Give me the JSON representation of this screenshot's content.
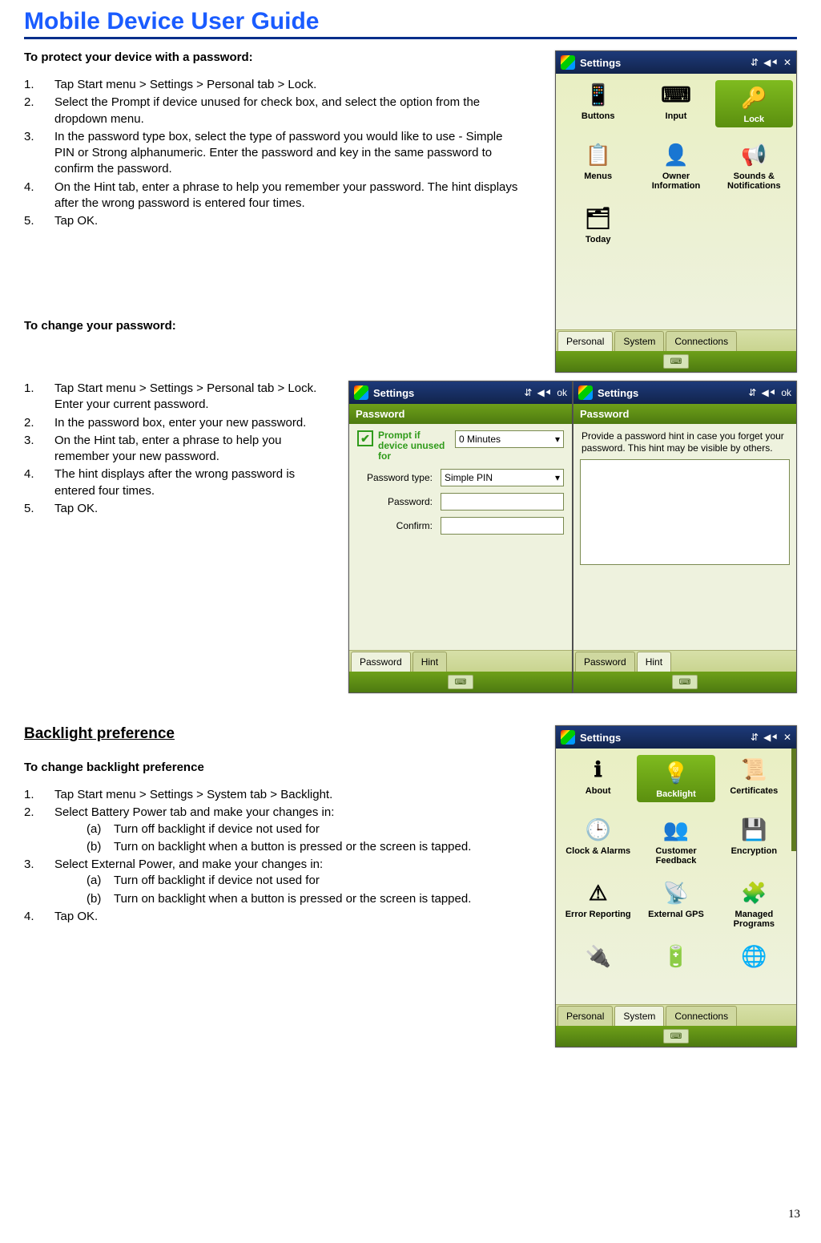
{
  "doc_title": "Mobile Device User Guide",
  "page_number": "13",
  "sections": {
    "protect_heading": "To protect your device with a password:",
    "protect_steps": [
      "Tap Start menu > Settings > Personal tab > Lock.",
      "Select the Prompt if device unused for check box, and select the option from the dropdown menu.",
      "In the password type box, select the type of password you would like to use - Simple PIN or Strong alphanumeric. Enter the password and key in the same password to confirm the password.",
      "On the Hint tab, enter a phrase to help you remember your password. The hint displays after the wrong password is entered four times.",
      "Tap OK."
    ],
    "change_heading": "To change your password:",
    "change_steps": [
      "Tap Start menu > Settings > Personal tab > Lock. Enter your current password.",
      "In the password box, enter your new password.",
      "On the Hint tab, enter a phrase to help you remember your new password.",
      "The hint displays after the wrong password is entered four times.",
      "Tap OK."
    ],
    "backlight_heading": "Backlight preference",
    "backlight_sub": "To change backlight preference",
    "backlight_steps": [
      {
        "text": "Tap Start menu > Settings > System tab > Backlight."
      },
      {
        "text": "Select Battery Power tab and make your changes in:",
        "sub": [
          {
            "k": "(a)",
            "v": "Turn off backlight if device not used for"
          },
          {
            "k": "(b)",
            "v": "Turn on backlight when a button is pressed or the screen is tapped."
          }
        ]
      },
      {
        "text": "Select External Power, and make your changes in:",
        "sub": [
          {
            "k": "(a)",
            "v": "Turn off backlight if device not used for"
          },
          {
            "k": "(b)",
            "v": "Turn on backlight when a button is pressed or the screen is tapped."
          }
        ]
      },
      {
        "text": "Tap OK."
      }
    ]
  },
  "screens": {
    "settings_personal": {
      "title": "Settings",
      "ok_label": "✕",
      "icons_sig": "⇵",
      "icons_vol": "◀⯇",
      "items": [
        {
          "label": "Buttons",
          "glyph": "📱"
        },
        {
          "label": "Input",
          "glyph": "⌨"
        },
        {
          "label": "Lock",
          "glyph": "🔑",
          "selected": true
        },
        {
          "label": "Menus",
          "glyph": "📋"
        },
        {
          "label": "Owner Information",
          "glyph": "👤"
        },
        {
          "label": "Sounds & Notifications",
          "glyph": "📢"
        },
        {
          "label": "Today",
          "glyph": "🗂"
        }
      ],
      "tabs": [
        "Personal",
        "System",
        "Connections"
      ],
      "active_tab": 0
    },
    "password_form": {
      "title": "Settings",
      "ok_label": "ok",
      "header": "Password",
      "prompt_label": "Prompt if device unused for",
      "prompt_checked": true,
      "timeout": "0 Minutes",
      "type_label": "Password type:",
      "type_value": "Simple PIN",
      "pwd_label": "Password:",
      "confirm_label": "Confirm:",
      "tabs": [
        "Password",
        "Hint"
      ],
      "active_tab": 0
    },
    "hint_form": {
      "title": "Settings",
      "ok_label": "ok",
      "header": "Password",
      "hint_text": "Provide a password hint in case you forget your password.  This hint may be visible by others.",
      "tabs": [
        "Password",
        "Hint"
      ],
      "active_tab": 1
    },
    "settings_system": {
      "title": "Settings",
      "ok_label": "✕",
      "items": [
        {
          "label": "About",
          "glyph": "ℹ"
        },
        {
          "label": "Backlight",
          "glyph": "💡",
          "selected": true
        },
        {
          "label": "Certificates",
          "glyph": "📜"
        },
        {
          "label": "Clock & Alarms",
          "glyph": "🕒"
        },
        {
          "label": "Customer Feedback",
          "glyph": "👥"
        },
        {
          "label": "Encryption",
          "glyph": "💾"
        },
        {
          "label": "Error Reporting",
          "glyph": "⚠"
        },
        {
          "label": "External GPS",
          "glyph": "📡"
        },
        {
          "label": "Managed Programs",
          "glyph": "🧩"
        },
        {
          "label": "",
          "glyph": "🔌"
        },
        {
          "label": "",
          "glyph": "🔋"
        },
        {
          "label": "",
          "glyph": "🌐"
        }
      ],
      "tabs": [
        "Personal",
        "System",
        "Connections"
      ],
      "active_tab": 1
    }
  }
}
